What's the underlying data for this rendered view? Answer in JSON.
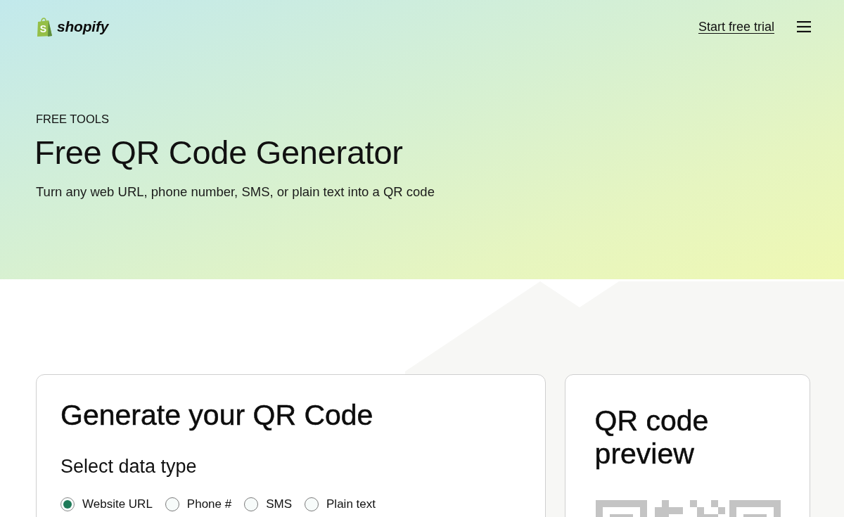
{
  "header": {
    "logo": {
      "mark": "S",
      "wordmark": "shopify"
    },
    "cta_link": "Start free trial"
  },
  "hero": {
    "eyebrow": "FREE TOOLS",
    "title": "Free QR Code Generator",
    "subtitle": "Turn any web URL, phone number, SMS, or plain text into a QR code"
  },
  "generator": {
    "title": "Generate your QR Code",
    "data_type_label": "Select data type",
    "data_types": [
      {
        "label": "Website URL",
        "selected": true
      },
      {
        "label": "Phone #",
        "selected": false
      },
      {
        "label": "SMS",
        "selected": false
      },
      {
        "label": "Plain text",
        "selected": false
      }
    ]
  },
  "preview": {
    "title": "QR code preview"
  }
}
